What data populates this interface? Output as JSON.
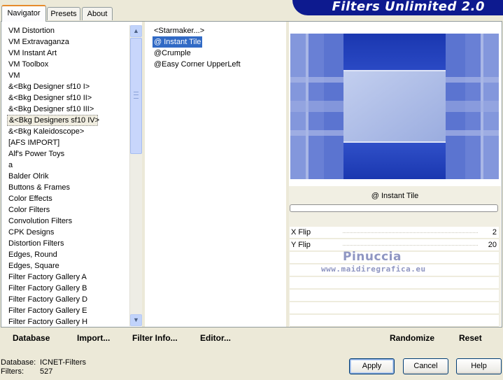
{
  "tabs": [
    "Navigator",
    "Presets",
    "About"
  ],
  "active_tab": "Navigator",
  "banner_title": "Filters Unlimited 2.0",
  "categories": [
    "VM Distortion",
    "VM Extravaganza",
    "VM Instant Art",
    "VM Toolbox",
    "VM",
    "&<Bkg Designer sf10 I>",
    "&<Bkg Designer sf10 II>",
    "&<Bkg Designer sf10 III>",
    "&<Bkg Designers sf10 IV>",
    "&<Bkg Kaleidoscope>",
    "[AFS IMPORT]",
    "Alf's Power Toys",
    "a",
    "Balder Olrik",
    "Buttons & Frames",
    "Color Effects",
    "Color Filters",
    "Convolution Filters",
    "CPK Designs",
    "Distortion Filters",
    "Edges, Round",
    "Edges, Square",
    "Filter Factory Gallery A",
    "Filter Factory Gallery B",
    "Filter Factory Gallery D",
    "Filter Factory Gallery E",
    "Filter Factory Gallery H"
  ],
  "selected_category_index": 8,
  "filters": [
    "<Starmaker...>",
    "@ Instant Tile",
    "@Crumple",
    "@Easy Corner UpperLeft"
  ],
  "selected_filter_index": 1,
  "selected_filter_name": "@ Instant Tile",
  "params": [
    {
      "label": "X Flip",
      "value": "2"
    },
    {
      "label": "Y Flip",
      "value": "20"
    }
  ],
  "watermark": {
    "name": "Pinuccia",
    "url": "www.maidiregrafica.eu"
  },
  "toolbar": {
    "database": "Database",
    "import": "Import...",
    "filter_info": "Filter Info...",
    "editor": "Editor...",
    "randomize": "Randomize",
    "reset": "Reset"
  },
  "footer": {
    "database_label": "Database:",
    "database_value": "ICNET-Filters",
    "filters_label": "Filters:",
    "filters_value": "527"
  },
  "dialog_buttons": {
    "apply": "Apply",
    "cancel": "Cancel",
    "help": "Help"
  },
  "colors": {
    "selection": "#316ac5",
    "banner": "#0d1a8f",
    "preview_dark": "#1e3bb5",
    "preview_light": "#b7c4ea"
  }
}
